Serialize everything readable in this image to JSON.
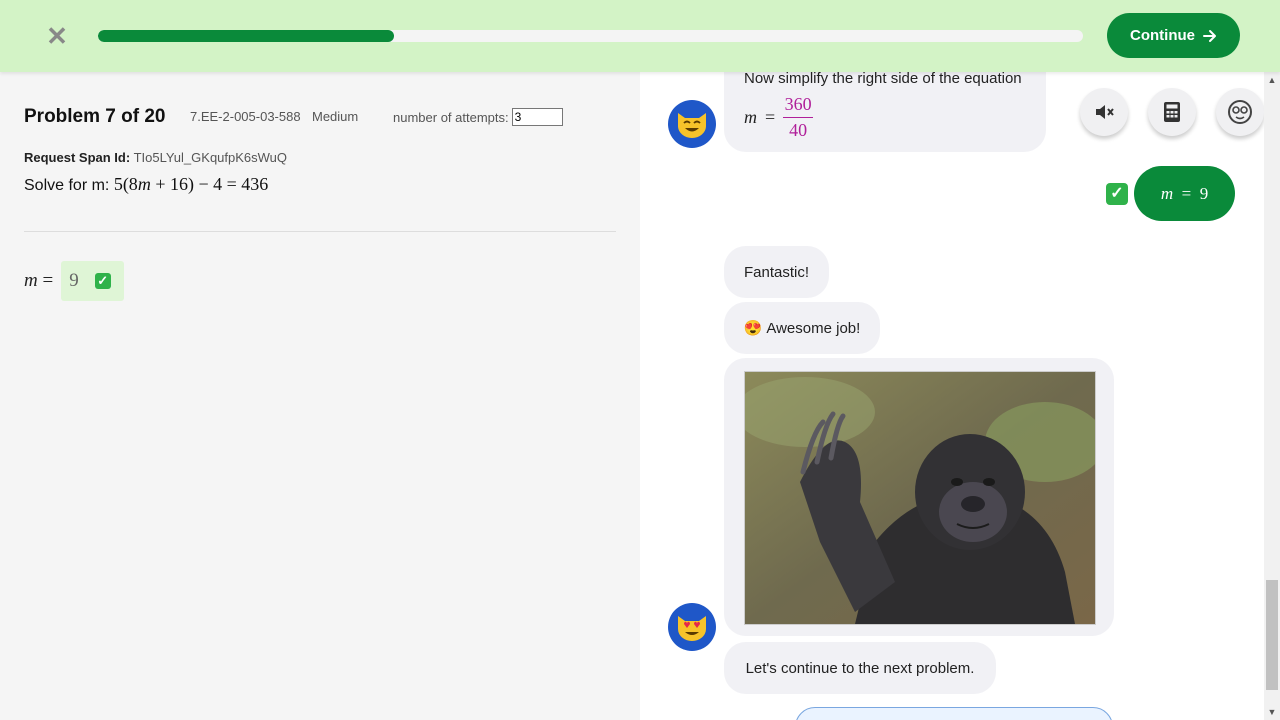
{
  "topbar": {
    "close_glyph": "✕",
    "progress_fraction": 0.3,
    "continue_label": "Continue"
  },
  "problem": {
    "title": "Problem 7 of 20",
    "code": "7.EE-2-005-03-588",
    "difficulty": "Medium",
    "attempts_label": "number of attempts:",
    "attempts_value": "3",
    "span_label": "Request Span Id:",
    "span_value": "TIo5LYul_GKqufpK6sWuQ",
    "solve_prefix": "Solve for m:",
    "equation": {
      "p1": "5(8",
      "p2": "m",
      "p3": " + 16) − 4 = 436"
    }
  },
  "answer": {
    "variable": "m",
    "equals": "=",
    "value": "9",
    "status_icon": "check-icon"
  },
  "chat": {
    "simplify_text": "Now simplify the right side of the equation",
    "frac_var": "m",
    "frac_eq": "=",
    "numerator": "360",
    "denominator": "40",
    "user_answer_var": "m",
    "user_answer_eq": "=",
    "user_answer_val": "9",
    "fantastic": "Fantastic!",
    "awesome_emoji": "😍",
    "awesome": "Awesome job!",
    "next": "Let's continue to the next problem.",
    "avatar1_icon": "smiling-cat-icon",
    "avatar2_icon": "heart-eyes-cat-icon",
    "photo_icon": "gorilla-photo"
  },
  "tools": {
    "mute_icon": "speaker-mute-icon",
    "calculator_icon": "calculator-icon",
    "face_icon": "face-icon"
  },
  "colors": {
    "brand_green": "#0a8a3a",
    "topbar_bg": "#d3f3c6",
    "avatar_blue": "#1f57c8",
    "fraction_magenta": "#b0209a"
  }
}
